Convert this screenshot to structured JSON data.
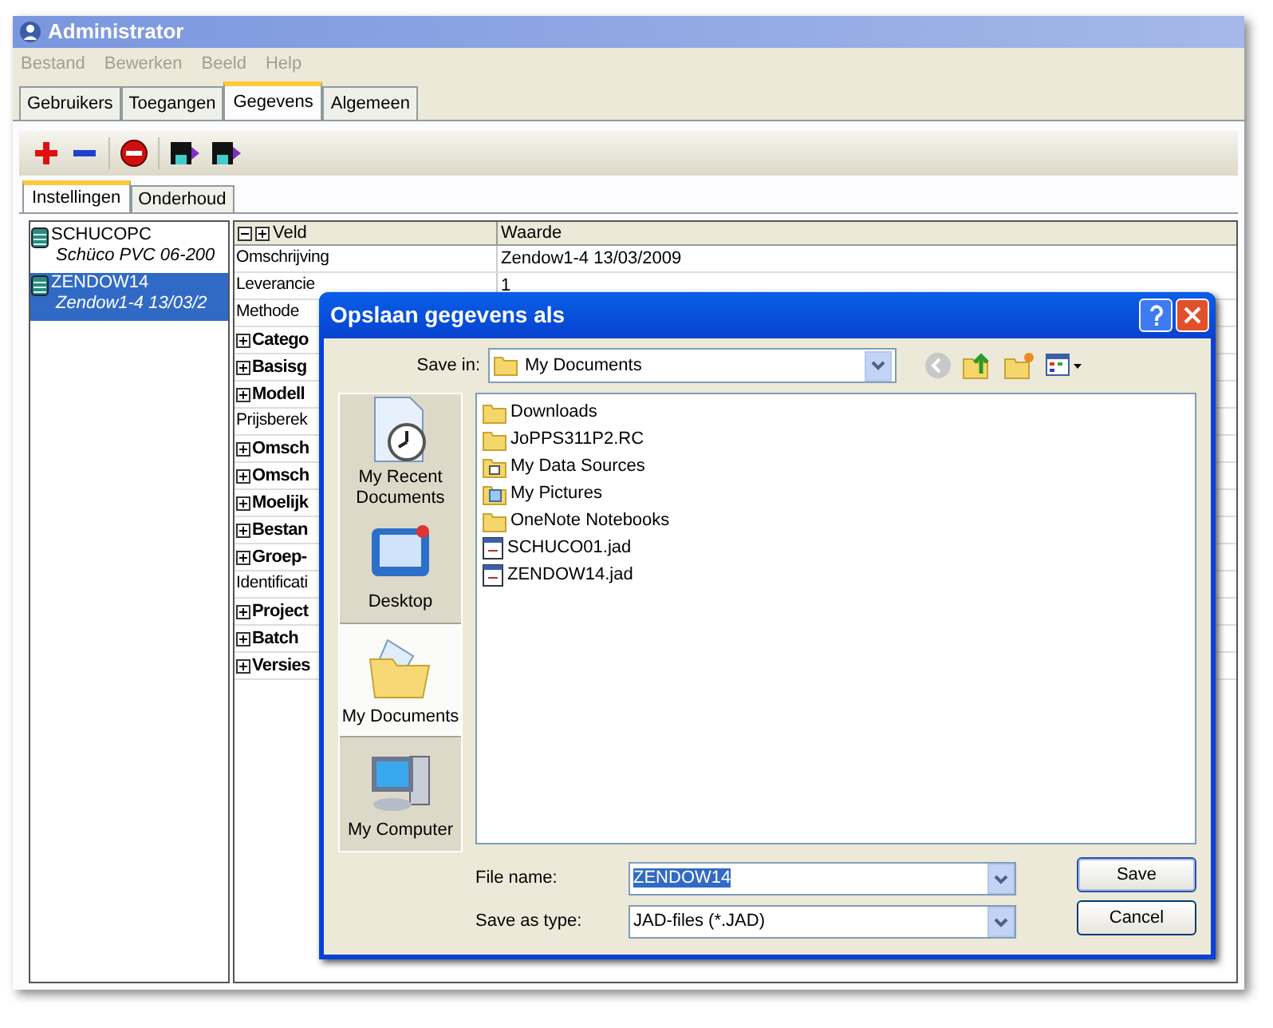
{
  "window": {
    "title": "Administrator"
  },
  "menu": [
    {
      "label": "Bestand",
      "disabled": true
    },
    {
      "label": "Bewerken",
      "disabled": true
    },
    {
      "label": "Beeld",
      "disabled": true
    },
    {
      "label": "Help",
      "disabled": true
    }
  ],
  "tabs": [
    {
      "label": "Gebruikers",
      "selected": false
    },
    {
      "label": "Toegangen",
      "selected": false
    },
    {
      "label": "Gegevens",
      "selected": true
    },
    {
      "label": "Algemeen",
      "selected": false
    }
  ],
  "subtabs": [
    {
      "label": "Instellingen",
      "selected": true
    },
    {
      "label": "Onderhoud",
      "selected": false
    }
  ],
  "tree": [
    {
      "name": "SCHUCOPC",
      "description": "Schüco PVC 06-200",
      "selected": false
    },
    {
      "name": "ZENDOW14",
      "description": "Zendow1-4 13/03/2",
      "selected": true
    }
  ],
  "grid": {
    "columns": [
      "Veld",
      "Waarde"
    ],
    "rows": [
      {
        "kind": "plain",
        "field": "Omschrijving",
        "value": "Zendow1-4 13/03/2009"
      },
      {
        "kind": "plain",
        "field": "Leverancie",
        "value": "1"
      },
      {
        "kind": "plain",
        "field": "Methode"
      },
      {
        "kind": "group",
        "field": "Catego"
      },
      {
        "kind": "group",
        "field": "Basisg"
      },
      {
        "kind": "group",
        "field": "Modell"
      },
      {
        "kind": "plain",
        "field": "Prijsberek"
      },
      {
        "kind": "group",
        "field": "Omsch"
      },
      {
        "kind": "group",
        "field": "Omsch"
      },
      {
        "kind": "group",
        "field": "Moelijk"
      },
      {
        "kind": "group",
        "field": "Bestan"
      },
      {
        "kind": "group",
        "field": "Groep-"
      },
      {
        "kind": "plain",
        "field": "Identificati"
      },
      {
        "kind": "group",
        "field": "Project"
      },
      {
        "kind": "group",
        "field": "Batch"
      },
      {
        "kind": "group",
        "field": "Versies"
      }
    ]
  },
  "dialog": {
    "title": "Opslaan gegevens als",
    "save_in_label": "Save in:",
    "save_in": "My Documents",
    "places": [
      {
        "kind": "recent",
        "label": "My Recent Documents",
        "selected": false
      },
      {
        "kind": "desktop",
        "label": "Desktop",
        "selected": false
      },
      {
        "kind": "documents",
        "label": "My Documents",
        "selected": true
      },
      {
        "kind": "computer",
        "label": "My Computer",
        "selected": false
      }
    ],
    "files": [
      {
        "kind": "folder",
        "name": "Downloads"
      },
      {
        "kind": "folder",
        "name": "JoPPS311P2.RC"
      },
      {
        "kind": "datasources",
        "name": "My Data Sources"
      },
      {
        "kind": "pictures",
        "name": "My Pictures"
      },
      {
        "kind": "folder",
        "name": "OneNote Notebooks"
      },
      {
        "kind": "jad",
        "name": "SCHUCO01.jad"
      },
      {
        "kind": "jad",
        "name": "ZENDOW14.jad"
      }
    ],
    "file_name_label": "File name:",
    "file_name": "ZENDOW14",
    "type_label": "Save as type:",
    "type": "JAD-files (*.JAD)",
    "buttons": [
      "Save",
      "Cancel"
    ]
  }
}
